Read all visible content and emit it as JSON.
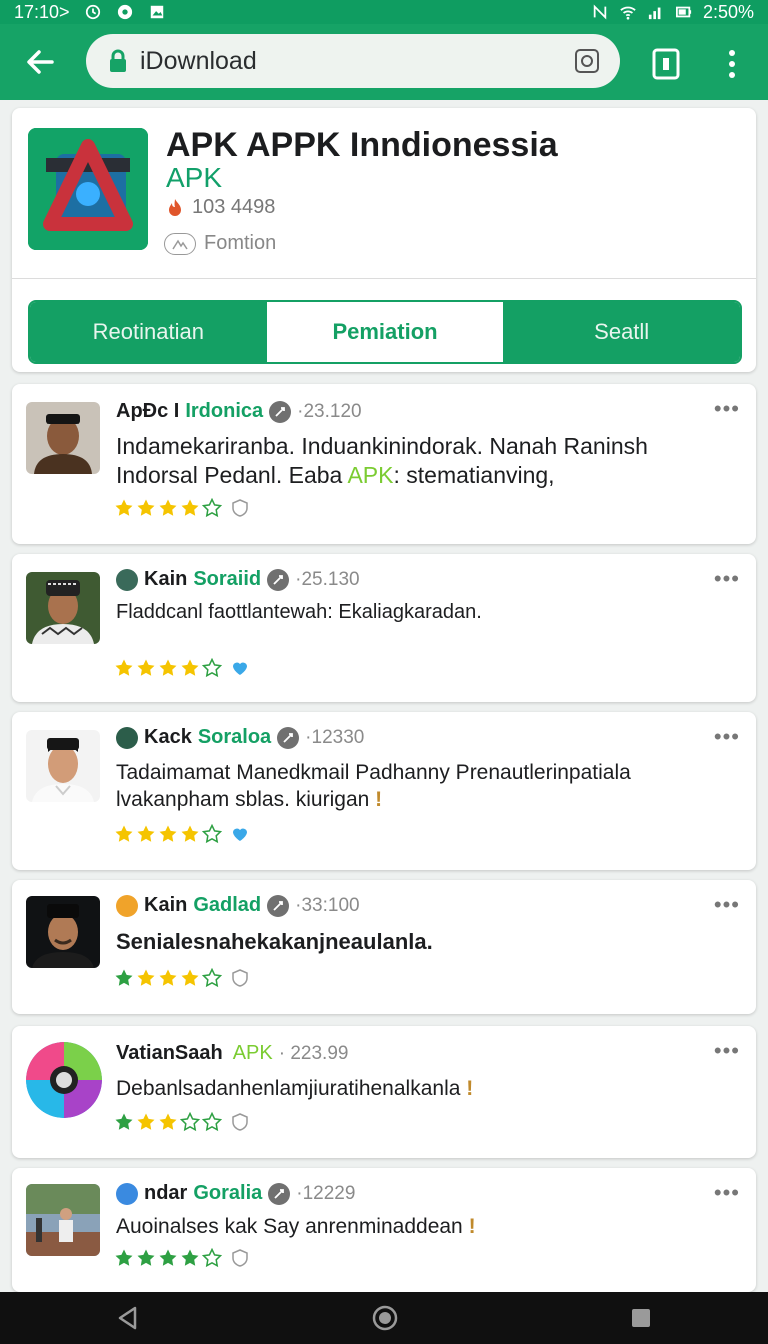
{
  "status_bar": {
    "time_left": "17:10>",
    "right_text": "2:50%"
  },
  "browser": {
    "url": "iDownload"
  },
  "app": {
    "title": "APK APPK Inndionessia",
    "subtitle": "APK",
    "downloads": "103 4498",
    "category": "Fomtion",
    "tabs": [
      {
        "label": "Reotinatian"
      },
      {
        "label": "Pemiation"
      },
      {
        "label": "Seatll"
      }
    ]
  },
  "reviews": [
    {
      "name": "ApÐc I",
      "name2": "Irdonica",
      "date": "·23.120",
      "text_a": "Indamekariranba. Induankinindorak. Nanah Raninsh Indorsal Pedanl. Eaba ",
      "text_apk": "APK",
      "text_b": ": stematianving,",
      "stars": 4
    },
    {
      "name": "Kain",
      "name2": "Soraiid",
      "date": "·25.130",
      "text": "Fladdcanl faottlantewah: Ekaliagkaradan.",
      "stars": 4
    },
    {
      "name": "Kack",
      "name2": "Soraloa",
      "date": "·12330",
      "text": "Tadaimamat Manedkmail Padhanny Prenautlerinpatiala lvakanpham sblas. kiurigan",
      "stars": 4
    },
    {
      "name": "Kain",
      "name2": "Gadlad",
      "date": "·33:100",
      "text": "Senialesnahekakanjneaulanla.",
      "stars": 4
    },
    {
      "name": "VatianSaah",
      "name2": "APK",
      "date": "· 223.99",
      "text": "Debanlsadanhenlamjiuratihenalkanla",
      "stars": 3
    },
    {
      "name": "ndar",
      "name2": "Goralia",
      "date": "·12229",
      "text": "Auoinalses kak Say anrenminaddean",
      "stars": 4
    }
  ],
  "colors": {
    "brand_green": "#16a366",
    "star_yellow": "#f5c400",
    "star_green": "#2ea043"
  }
}
